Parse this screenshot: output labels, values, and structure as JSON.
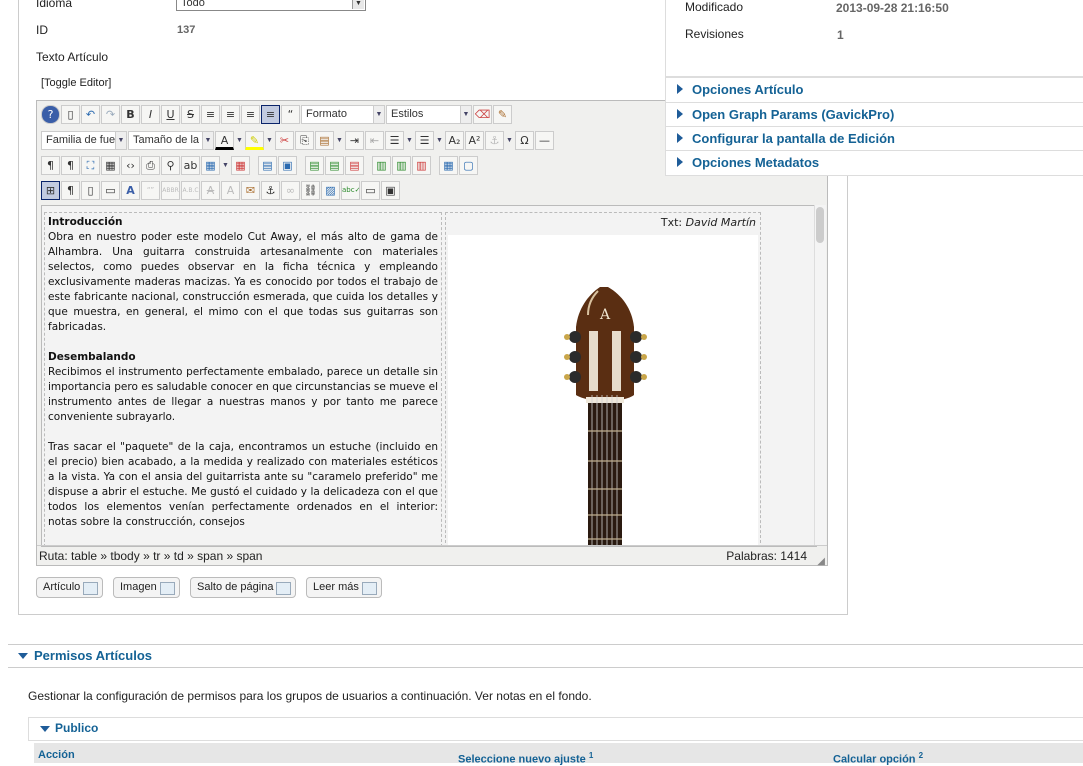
{
  "form": {
    "idioma_label": "Idioma",
    "idioma_value": "Todo",
    "id_label": "ID",
    "id_value": "137",
    "texto_label": "Texto Artículo",
    "toggle_editor": "[Toggle Editor]"
  },
  "info": {
    "modificado_label": "Modificado",
    "modificado_value": "2013-09-28 21:16:50",
    "revisiones_label": "Revisiones",
    "revisiones_value": "1"
  },
  "panels": [
    "Opciones Artículo",
    "Open Graph Params (GavickPro)",
    "Configurar la pantalla de Edición",
    "Opciones Metadatos"
  ],
  "toolbar": {
    "formato": "Formato",
    "estilos": "Estilos",
    "familia": "Familia de fuer",
    "tamano": "Tamaño de la f"
  },
  "content": {
    "credit_prefix": "Txt:",
    "credit_name": "David Martín",
    "h1": "Introducción",
    "p1": "Obra en nuestro poder este modelo Cut Away, el más alto de gama de Alhambra. Una guitarra construida artesanalmente con materiales selectos, como puedes observar en la ficha técnica y empleando exclusivamente maderas macizas. Ya es conocido por todos el trabajo de este fabricante nacional, construcción esmerada, que cuida los detalles y que muestra, en general, el mimo con el que todas sus guitarras son fabricadas.",
    "h2": "Desembalando",
    "p2": "Recibimos el instrumento perfectamente embalado, parece un detalle sin importancia pero es saludable conocer en que circunstancias se mueve el instrumento antes de llegar a nuestras manos y por tanto me parece conveniente subrayarlo.",
    "p3": "Tras sacar el \"paquete\" de la caja, encontramos un estuche (incluido en el precio) bien acabado, a la medida y realizado con materiales estéticos a la vista. Ya con el ansia del guitarrista ante su \"caramelo preferido\" me dispuse a abrir el estuche. Me gustó el cuidado y la delicadeza con el que todos los elementos venían perfectamente ordenados en el interior: notas sobre la construcción, consejos"
  },
  "status": {
    "path": "Ruta:  table » tbody » tr » td » span » span",
    "words": "Palabras: 1414"
  },
  "buttons": [
    "Artículo",
    "Imagen",
    "Salto de página",
    "Leer más"
  ],
  "permisos": {
    "title": "Permisos Artículos",
    "desc": "Gestionar la configuración de permisos para los grupos de usuarios a continuación. Ver notas en el fondo.",
    "group": "Publico",
    "col_accion": "Acción",
    "col_nuevo": "Seleccione nuevo ajuste",
    "col_nuevo_sup": "1",
    "col_calc": "Calcular opción",
    "col_calc_sup": "2"
  },
  "colors": {
    "link_blue": "#146295",
    "accent": "#1f5c99"
  }
}
